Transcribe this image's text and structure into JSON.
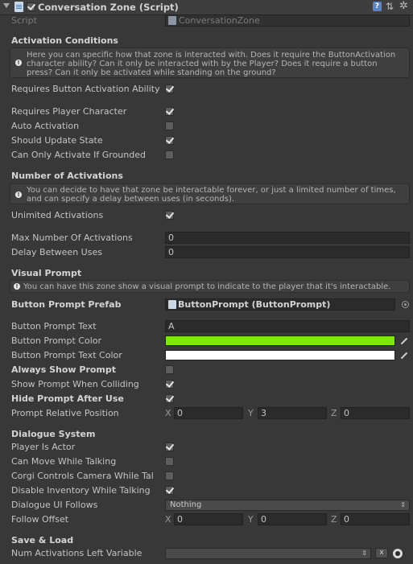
{
  "header": {
    "title": "Conversation Zone (Script)",
    "enabled": true,
    "icons": [
      "foldout-arrow-icon",
      "script-icon",
      "help-icon",
      "preset-icon",
      "gear-icon"
    ]
  },
  "script": {
    "label": "Script",
    "value": "ConversationZone"
  },
  "activation": {
    "title": "Activation Conditions",
    "help": "Here you can specific how that zone is interacted with. Does it require the ButtonActivation character ability? Can it only be interacted with by the Player? Does it require a button press? Can it only be activated while standing on the ground?",
    "requires_button_activation_ability": {
      "label": "Requires Button Activation Ability",
      "checked": true
    },
    "requires_player_character": {
      "label": "Requires Player Character",
      "checked": true
    },
    "auto_activation": {
      "label": "Auto Activation",
      "checked": false
    },
    "should_update_state": {
      "label": "Should Update State",
      "checked": true
    },
    "can_only_activate_if_grounded": {
      "label": "Can Only Activate If Grounded",
      "checked": false
    }
  },
  "activations": {
    "title": "Number of Activations",
    "help": "You can decide to have that zone be interactable forever, or just a limited number of times, and can specify a delay between uses (in seconds).",
    "unlimited": {
      "label": "Unimited Activations",
      "checked": true
    },
    "max_number": {
      "label": "Max Number Of Activations",
      "value": "0"
    },
    "delay": {
      "label": "Delay Between Uses",
      "value": "0"
    }
  },
  "visual": {
    "title": "Visual Prompt",
    "help": "You can have this zone show a visual prompt to indicate to the player that it's interactable.",
    "button_prompt_prefab": {
      "label": "Button Prompt Prefab",
      "value": "ButtonPrompt (ButtonPrompt)"
    },
    "button_prompt_text": {
      "label": "Button Prompt Text",
      "value": "A"
    },
    "button_prompt_color": {
      "label": "Button Prompt Color",
      "color": "#7fe60a"
    },
    "button_prompt_text_color": {
      "label": "Button Prompt Text Color",
      "color": "#ffffff"
    },
    "always_show_prompt": {
      "label": "Always Show Prompt",
      "checked": false
    },
    "show_prompt_when_colliding": {
      "label": "Show Prompt When Colliding",
      "checked": true
    },
    "hide_prompt_after_use": {
      "label": "Hide Prompt After Use",
      "checked": true
    },
    "prompt_relative_position": {
      "label": "Prompt Relative Position",
      "x_label": "X",
      "x": "0",
      "y_label": "Y",
      "y": "3",
      "z_label": "Z",
      "z": "0"
    }
  },
  "dialogue": {
    "title": "Dialogue System",
    "player_is_actor": {
      "label": "Player Is Actor",
      "checked": true
    },
    "can_move_while_talking": {
      "label": "Can Move While Talking",
      "checked": false
    },
    "corgi_controls_camera": {
      "label": "Corgi Controls Camera While Tal",
      "checked": false
    },
    "disable_inventory": {
      "label": "Disable Inventory While Talking",
      "checked": true
    },
    "dialogue_ui_follows": {
      "label": "Dialogue UI Follows",
      "value": "Nothing"
    },
    "follow_offset": {
      "label": "Follow Offset",
      "x_label": "X",
      "x": "0",
      "y_label": "Y",
      "y": "0",
      "z_label": "Z",
      "z": "0"
    }
  },
  "save_load": {
    "title": "Save & Load",
    "num_activations_left_variable": {
      "label": "Num Activations Left Variable",
      "value": "",
      "clear_label": "x"
    }
  },
  "colors": {
    "background": "#383838",
    "field": "#2b2b2b",
    "text": "#c4c4c4"
  }
}
